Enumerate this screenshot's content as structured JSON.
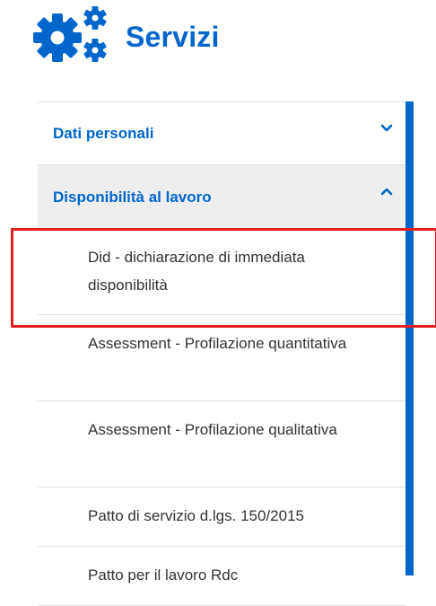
{
  "header": {
    "title": "Servizi",
    "icon": "gears-icon",
    "color": "#0066cc"
  },
  "menu": {
    "sections": [
      {
        "label": "Dati personali",
        "expanded": false,
        "chevron": "chevron-down-icon"
      },
      {
        "label": "Disponibilità al lavoro",
        "expanded": true,
        "chevron": "chevron-up-icon"
      }
    ],
    "items": [
      {
        "label": "Did - dichiarazione di immediata disponibilità",
        "highlighted": true
      },
      {
        "label": "Assessment - Profilazione quantitativa"
      },
      {
        "label": "Assessment - Profilazione qualitativa"
      },
      {
        "label": "Patto di servizio d.lgs. 150/2015"
      },
      {
        "label": "Patto per il lavoro Rdc"
      }
    ]
  },
  "colors": {
    "accent": "#0066cc",
    "highlight": "#e32020",
    "section_bg": "#eeeeee"
  }
}
